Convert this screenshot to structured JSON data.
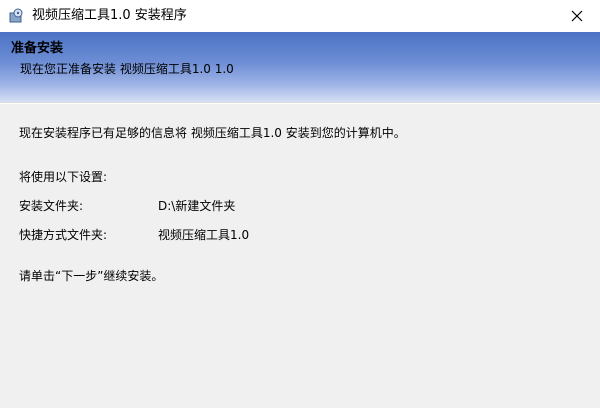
{
  "window": {
    "title": "视频压缩工具1.0 安装程序",
    "close_glyph": "✕",
    "app_icon": "installer-icon"
  },
  "header": {
    "title": "准备安装",
    "subtitle": "现在您正准备安装 视频压缩工具1.0 1.0"
  },
  "body": {
    "intro": "现在安装程序已有足够的信息将 视频压缩工具1.0 安装到您的计算机中。",
    "settings_heading": "将使用以下设置:",
    "settings": [
      {
        "label": "安装文件夹:",
        "value": "D:\\新建文件夹"
      },
      {
        "label": "快捷方式文件夹:",
        "value": "视频压缩工具1.0"
      }
    ],
    "continue_message": "请单击“下一步”继续安装。"
  },
  "colors": {
    "header_gradient_top": "#4a72c4",
    "header_gradient_bottom": "#d6dff4",
    "content_background": "#f0f0f0"
  }
}
